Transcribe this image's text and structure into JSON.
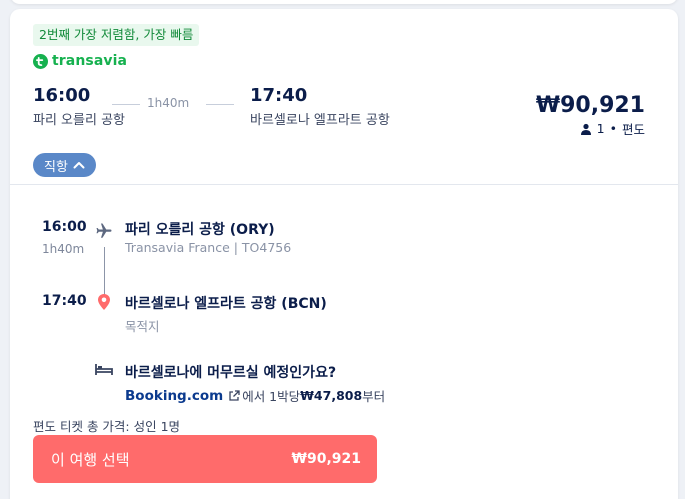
{
  "badge": "2번째 가장 저렴함, 가장 빠름",
  "airline": {
    "name": "transavia",
    "brand_color": "#16b14f"
  },
  "summary": {
    "depart_time": "16:00",
    "depart_airport": "파리 오를리 공항",
    "duration": "1h40m",
    "arrive_time": "17:40",
    "arrive_airport": "바르셀로나 엘프라트 공항",
    "price": "₩90,921",
    "passengers": "1",
    "trip_type": "편도"
  },
  "direct_toggle": {
    "label": "직항",
    "icon": "chevron-up-icon"
  },
  "timeline": {
    "depart_time": "16:00",
    "duration": "1h40m",
    "depart_name": "파리 오를리 공항 (ORY)",
    "carrier_info": "Transavia France | TO4756",
    "arrive_time": "17:40",
    "arrive_name": "바르셀로나 엘프라트 공항 (BCN)",
    "arrive_sub": "목적지"
  },
  "hotel": {
    "question": "바르셀로나에 머무르실 예정인가요?",
    "brand": "Booking.com",
    "text_prefix": "에서 1박당 ",
    "price": "₩47,808",
    "text_suffix": "부터"
  },
  "total_label": "편도 티켓 총 가격: 성인 1명",
  "select_button": {
    "label": "이 여행 선택",
    "price": "₩90,921",
    "color": "#ff6b6b"
  }
}
